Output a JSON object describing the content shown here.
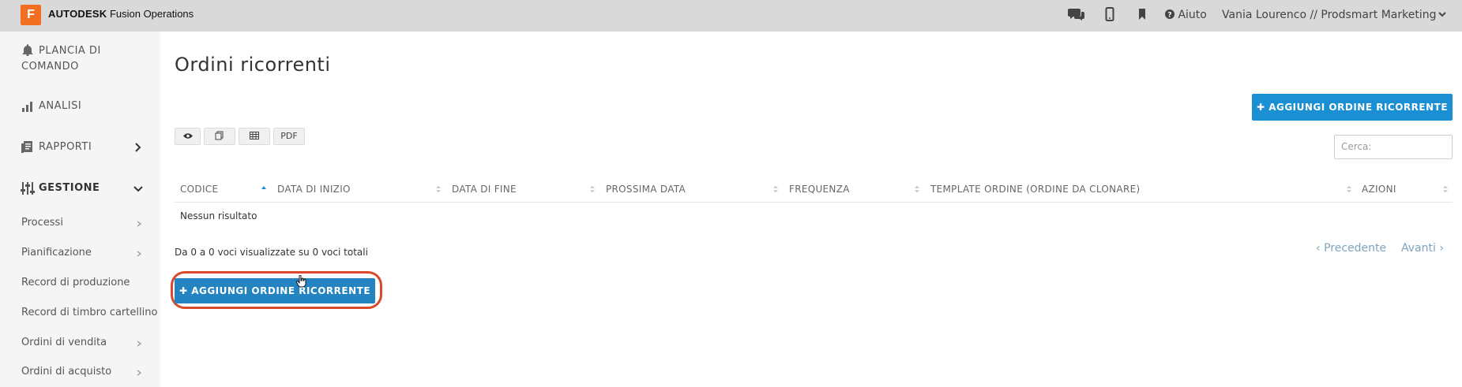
{
  "topbar": {
    "logo_letter": "F",
    "brand_bold": "AUTODESK",
    "brand_rest": "Fusion Operations",
    "help_label": "Aiuto",
    "user_label": "Vania Lourenco // Prodsmart Marketing"
  },
  "sidebar": {
    "dashboard": "PLANCIA DI COMANDO",
    "analysis": "ANALISI",
    "reports": "RAPPORTI",
    "management": "GESTIONE",
    "sub_items": [
      "Processi",
      "Pianificazione",
      "Record di produzione",
      "Record di timbro cartellino",
      "Ordini di vendita",
      "Ordini di acquisto"
    ]
  },
  "main": {
    "title": "Ordini ricorrenti",
    "add_button": "AGGIUNGI ORDINE RICORRENTE",
    "pdf_label": "PDF",
    "search_placeholder": "Cerca:",
    "columns": [
      "CODICE",
      "DATA DI INIZIO",
      "DATA DI FINE",
      "PROSSIMA DATA",
      "FREQUENZA",
      "TEMPLATE ORDINE (ORDINE DA CLONARE)",
      "AZIONI"
    ],
    "empty_text": "Nessun risultato",
    "info_text": "Da 0 a 0 voci visualizzate su 0 voci totali",
    "prev_label": "Precedente",
    "next_label": "Avanti"
  },
  "colors": {
    "primary": "#1a8fd4",
    "highlight": "#d84a2b",
    "brand": "#f26f21"
  }
}
